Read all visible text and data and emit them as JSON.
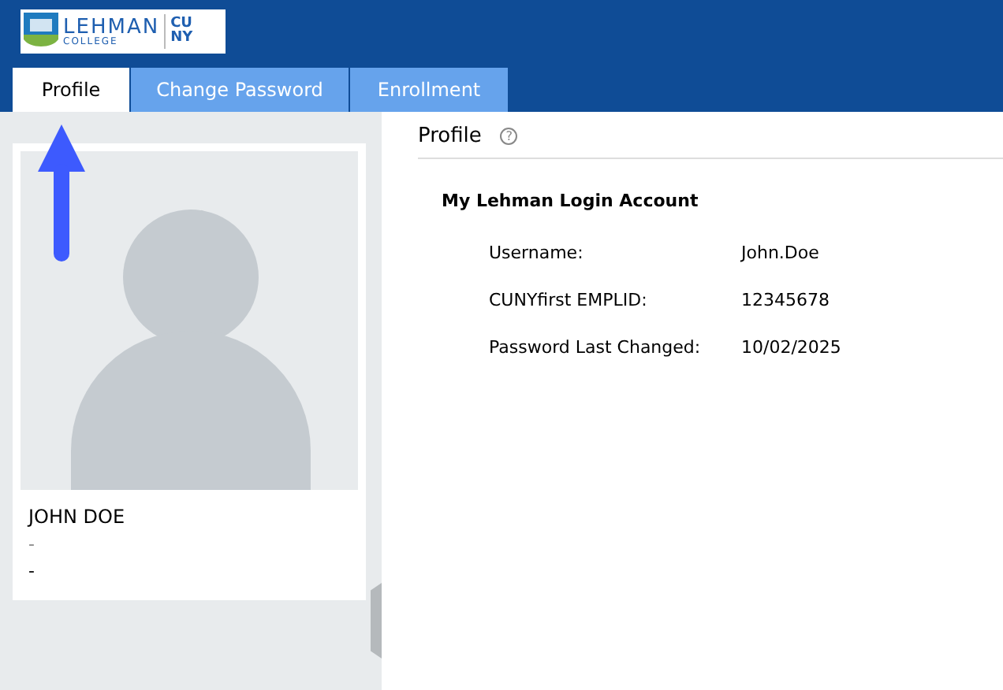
{
  "logo": {
    "name": "LEHMAN",
    "subtitle": "COLLEGE",
    "partner_top": "CU",
    "partner_bottom": "NY"
  },
  "tabs": [
    {
      "label": "Profile",
      "selected": true
    },
    {
      "label": "Change Password",
      "selected": false
    },
    {
      "label": "Enrollment",
      "selected": false
    }
  ],
  "profile_card": {
    "name": "JOHN DOE",
    "line_2": "-",
    "line_3": "-"
  },
  "panel": {
    "title": "Profile",
    "help": "?",
    "section": "My Lehman Login Account",
    "fields": [
      {
        "label": "Username:",
        "value": "John.Doe"
      },
      {
        "label": "CUNYfirst EMPLID:",
        "value": "12345678"
      },
      {
        "label": "Password Last Changed:",
        "value": "10/02/2025"
      }
    ]
  }
}
